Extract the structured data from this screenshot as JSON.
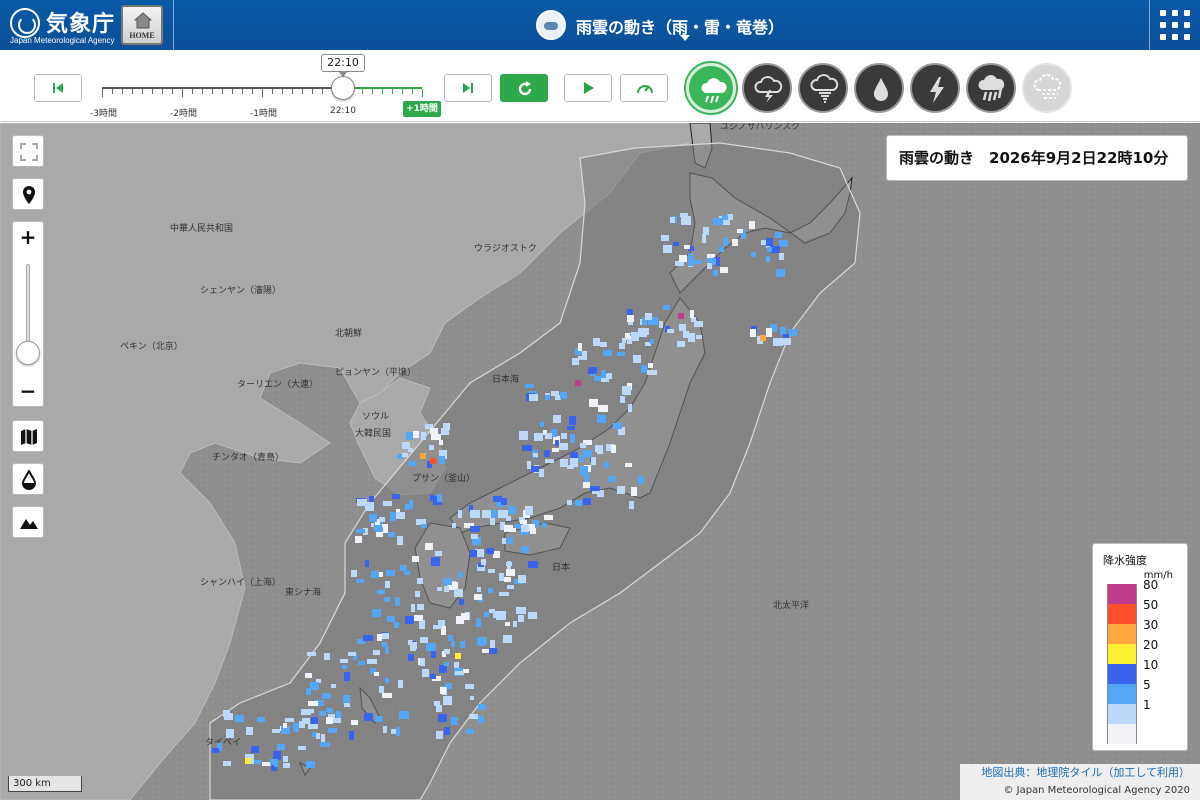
{
  "header": {
    "logo_text": "気象庁",
    "logo_sub": "Japan Meteorological Agency",
    "home_label": "HOME",
    "title": "雨雲の動き（雨・雷・竜巻）"
  },
  "timeline": {
    "current_time": "22:10",
    "labels": [
      "-3時間",
      "-2時間",
      "-1時間",
      "22:10"
    ],
    "future_label": "+1時間"
  },
  "modes": [
    {
      "name": "rain-cloud",
      "active": true
    },
    {
      "name": "thunder",
      "active": false
    },
    {
      "name": "tornado",
      "active": false
    },
    {
      "name": "precipitation",
      "active": false
    },
    {
      "name": "lightning",
      "active": false
    },
    {
      "name": "heavy-rain",
      "active": false
    },
    {
      "name": "snow",
      "active": false,
      "disabled": true
    }
  ],
  "map": {
    "info": "雨雲の動き　2026年9月2日22時10分",
    "scale": "300 km",
    "credit_link": "地図出典：地理院タイル（加工して利用）",
    "copyright": "© Japan Meteorological Agency 2020",
    "place_labels": [
      "中華人民共和国",
      "ウラジオストク",
      "シェンヤン（瀋陽）",
      "北朝鮮",
      "ペキン（北京）",
      "ピョンヤン（平壌）",
      "ターリエン（大連）",
      "ソウル",
      "大韓民国",
      "チンタオ（青島）",
      "プサン（釜山）",
      "シャンハイ（上海）",
      "東シナ海",
      "日本海",
      "北太平洋",
      "日本",
      "ユジノサハリンスク",
      "タイペイ"
    ]
  },
  "legend": {
    "title": "降水強度",
    "unit": "mm/h",
    "levels": [
      {
        "label": "80",
        "color": "#c03c8c"
      },
      {
        "label": "50",
        "color": "#ff4f2b"
      },
      {
        "label": "30",
        "color": "#ffa63c"
      },
      {
        "label": "20",
        "color": "#ffef2e"
      },
      {
        "label": "10",
        "color": "#3a63ef"
      },
      {
        "label": "5",
        "color": "#55a6f7"
      },
      {
        "label": "1",
        "color": "#bcd8fa"
      },
      {
        "label": "",
        "color": "#f0f2f8"
      }
    ]
  }
}
